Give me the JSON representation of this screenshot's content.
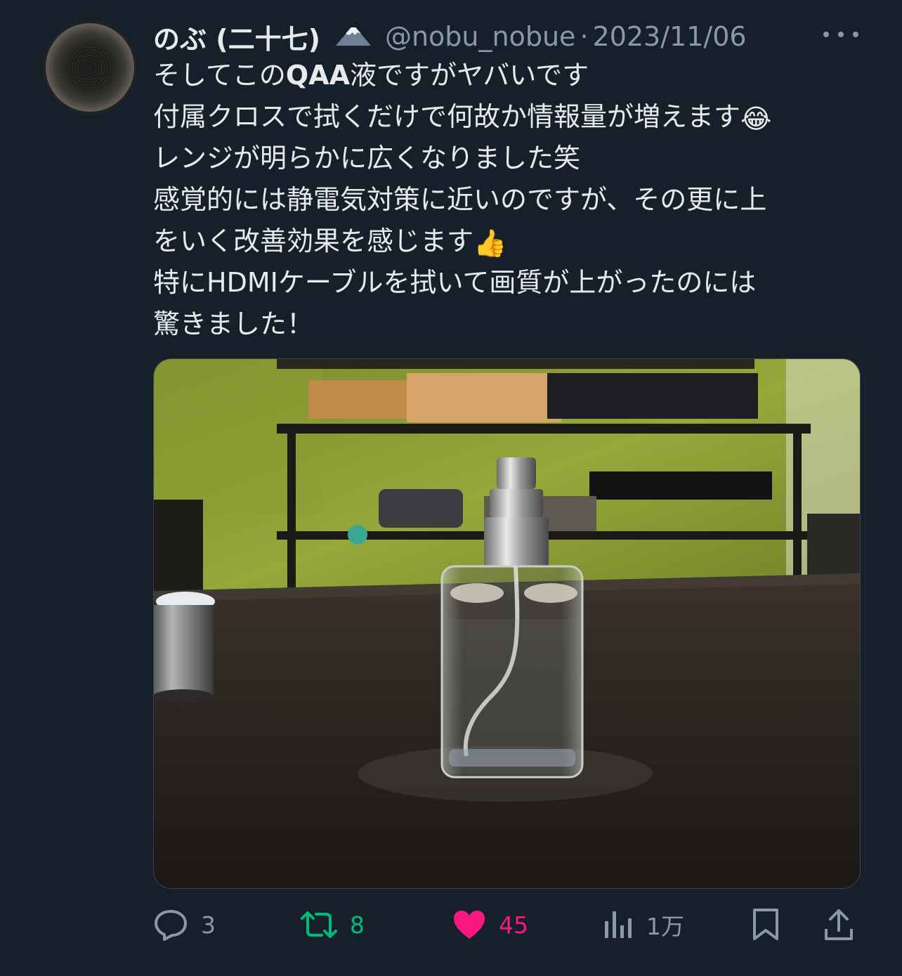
{
  "tweet": {
    "author_name": "のぶ (二十七)",
    "badge_icon": "mount-fuji-icon",
    "handle": "@nobu_nobue",
    "separator": "·",
    "date": "2023/11/06",
    "text_lines": [
      {
        "prefix": "そしてこの",
        "bold": "QAA",
        "suffix": "液ですがヤバいです"
      },
      {
        "text": "付属クロスで拭くだけで何故か情報量が増えます",
        "emoji": "😂"
      },
      {
        "text": "レンジが明らかに広くなりました笑"
      },
      {
        "text": "感覚的には静電気対策に近いのですが、その更に上"
      },
      {
        "text": "をいく改善効果を感じます",
        "emoji": "👍"
      },
      {
        "text": "特にHDMIケーブルを拭いて画質が上がったのには"
      },
      {
        "text": "驚きました！"
      }
    ]
  },
  "actions": {
    "reply_count": "3",
    "retweet_count": "8",
    "like_count": "45",
    "views_count": "1万"
  },
  "colors": {
    "background": "#15202b",
    "text": "#e7e9ea",
    "muted": "#8b98a5",
    "retweet": "#00ba7c",
    "like": "#f91880"
  }
}
